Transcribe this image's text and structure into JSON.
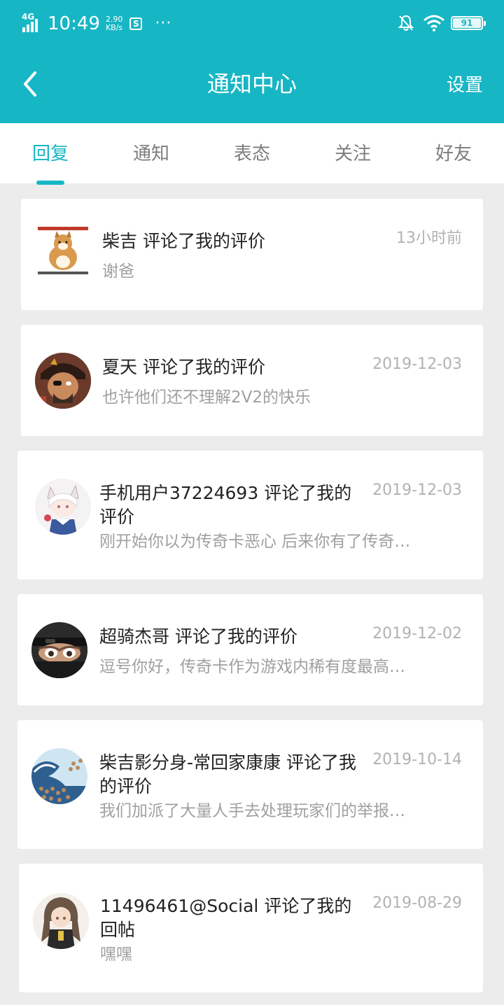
{
  "status_bar": {
    "network": "4G",
    "time": "10:49",
    "speed_value": "2.90",
    "speed_unit": "KB/s",
    "more": "···",
    "battery": "91"
  },
  "header": {
    "title": "通知中心",
    "settings_label": "设置",
    "back_icon": "chevron-left-icon",
    "accent_color": "#17b6c4"
  },
  "tabs": [
    {
      "label": "回复",
      "active": true
    },
    {
      "label": "通知",
      "active": false
    },
    {
      "label": "表态",
      "active": false
    },
    {
      "label": "关注",
      "active": false
    },
    {
      "label": "好友",
      "active": false
    }
  ],
  "notifications": [
    {
      "title": "柴吉 评论了我的评价",
      "time": "13小时前",
      "content": "谢爸"
    },
    {
      "title": "夏天 评论了我的评价",
      "time": "2019-12-03",
      "content": "也许他们还不理解2V2的快乐"
    },
    {
      "title": "手机用户37224693 评论了我的评价",
      "time": "2019-12-03",
      "content": "刚开始你以为传奇卡恶心 后来你有了传奇…"
    },
    {
      "title": "超骑杰哥 评论了我的评价",
      "time": "2019-12-02",
      "content": "逗号你好，传奇卡作为游戏内稀有度最高…"
    },
    {
      "title": "柴吉影分身-常回家康康 评论了我的评价",
      "time": "2019-10-14",
      "content": "我们加派了大量人手去处理玩家们的举报…"
    },
    {
      "title": "11496461@Social 评论了我的回帖",
      "time": "2019-08-29",
      "content": "嘿嘿"
    }
  ]
}
